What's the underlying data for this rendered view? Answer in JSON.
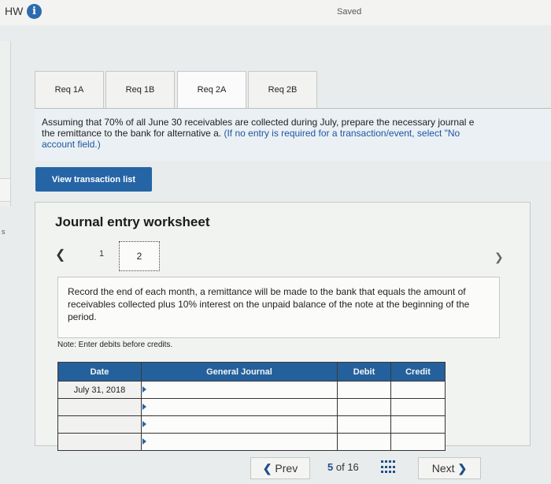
{
  "header": {
    "title": "HW",
    "info_icon": "info-icon",
    "status": "Saved"
  },
  "tabs": [
    {
      "label": "Req 1A",
      "active": false
    },
    {
      "label": "Req 1B",
      "active": false
    },
    {
      "label": "Req 2A",
      "active": true
    },
    {
      "label": "Req 2B",
      "active": false
    }
  ],
  "instructions": {
    "line1": "Assuming that 70% of all June 30 receivables are collected during July, prepare the necessary journal e",
    "line2_main": "the remittance to the bank for alternative a. ",
    "line2_hint": "(If no entry is required for a transaction/event, select \"No",
    "line3_hint": "account field.)"
  },
  "view_transactions_label": "View transaction list",
  "worksheet": {
    "title": "Journal entry worksheet",
    "pages": [
      "1",
      "2"
    ],
    "current_page": "2",
    "description": "Record the end of each month, a remittance will be made to the bank that equals the amount of receivables collected plus 10% interest on the unpaid balance of the note at the beginning of the period.",
    "note": "Note: Enter debits before credits."
  },
  "journal_table": {
    "headers": [
      "Date",
      "General Journal",
      "Debit",
      "Credit"
    ],
    "rows": [
      {
        "date": "July 31, 2018",
        "account": "",
        "debit": "",
        "credit": ""
      },
      {
        "date": "",
        "account": "",
        "debit": "",
        "credit": ""
      },
      {
        "date": "",
        "account": "",
        "debit": "",
        "credit": ""
      },
      {
        "date": "",
        "account": "",
        "debit": "",
        "credit": ""
      }
    ]
  },
  "pager": {
    "prev_label": "Prev",
    "current": "5",
    "of_label": "of",
    "total": "16",
    "next_label": "Next"
  },
  "left_edge_text": "s",
  "colors": {
    "accent_blue": "#2565a6",
    "table_header": "#24619c",
    "hint_text": "#1f55a5"
  }
}
